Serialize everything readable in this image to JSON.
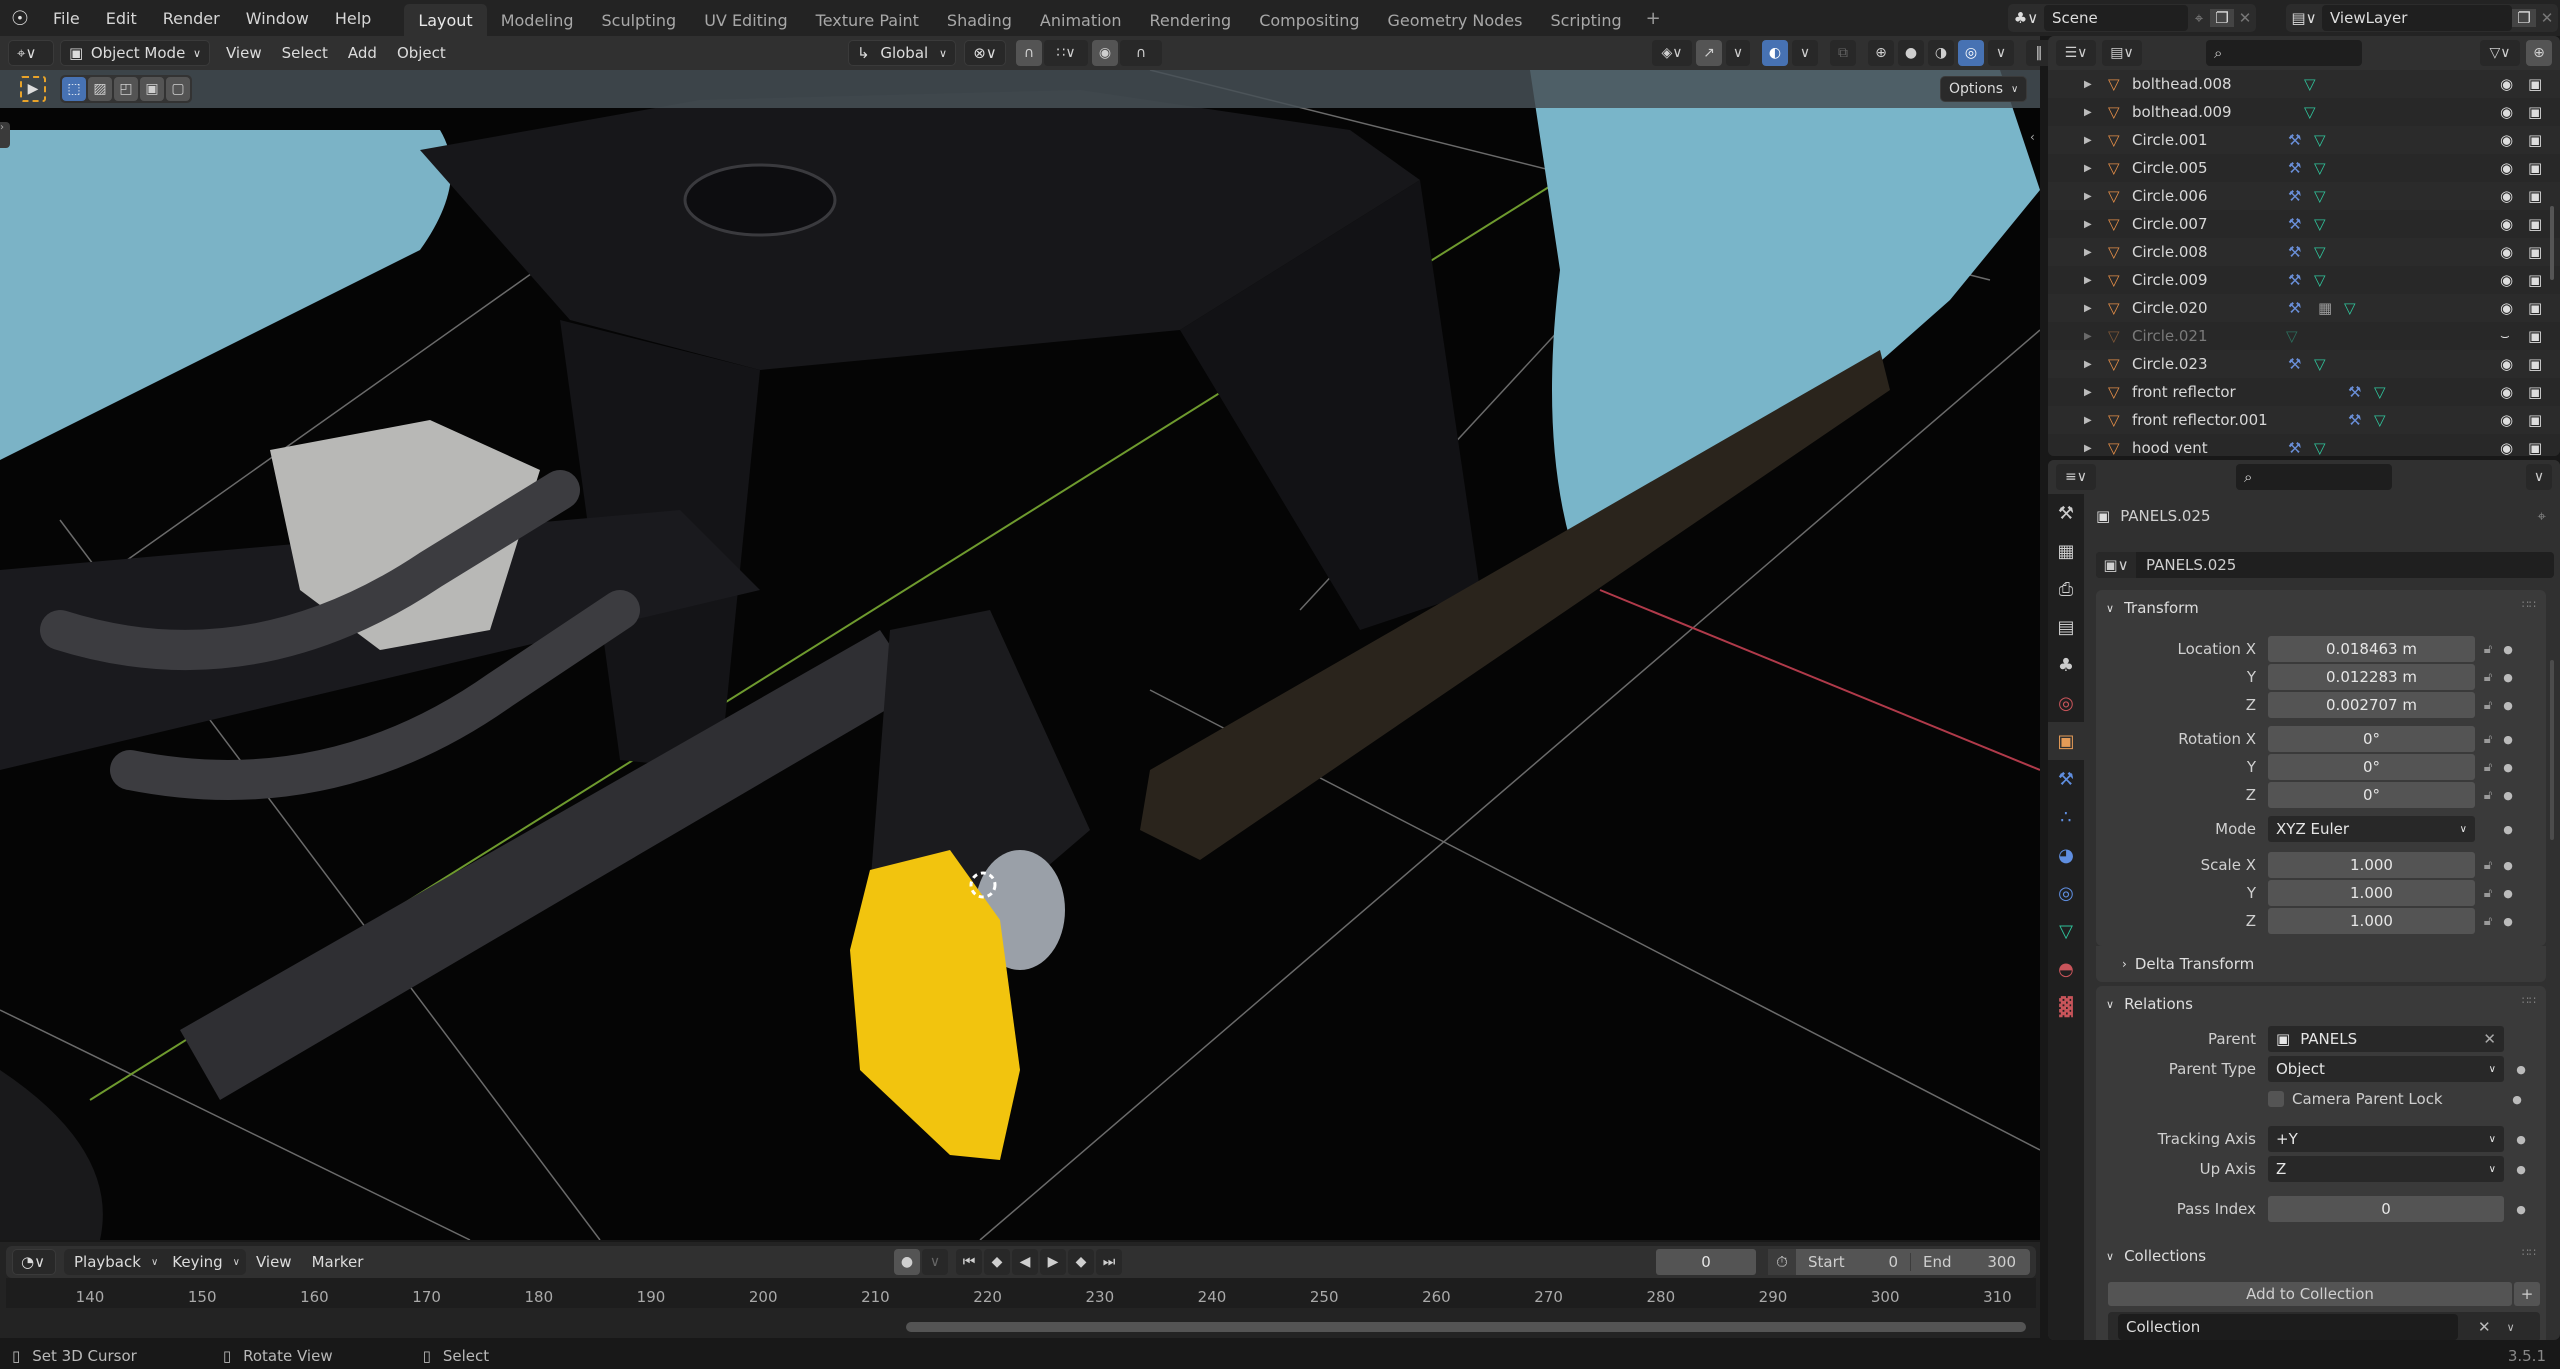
{
  "top_menu": [
    "File",
    "Edit",
    "Render",
    "Window",
    "Help"
  ],
  "workspaces": [
    {
      "label": "Layout",
      "active": true
    },
    {
      "label": "Modeling",
      "active": false
    },
    {
      "label": "Sculpting",
      "active": false
    },
    {
      "label": "UV Editing",
      "active": false
    },
    {
      "label": "Texture Paint",
      "active": false
    },
    {
      "label": "Shading",
      "active": false
    },
    {
      "label": "Animation",
      "active": false
    },
    {
      "label": "Rendering",
      "active": false
    },
    {
      "label": "Compositing",
      "active": false
    },
    {
      "label": "Geometry Nodes",
      "active": false
    },
    {
      "label": "Scripting",
      "active": false
    }
  ],
  "add_workspace": "+",
  "scene": {
    "name": "Scene",
    "view_layer": "ViewLayer"
  },
  "viewport_header": {
    "mode": "Object Mode",
    "menus": [
      "View",
      "Select",
      "Add",
      "Object"
    ],
    "orientation": "Global",
    "options_label": "Options"
  },
  "outliner": {
    "search_placeholder": "",
    "rows": [
      {
        "name": "bolthead.008",
        "modifier": false,
        "extra": false,
        "visible": true,
        "dim": false
      },
      {
        "name": "bolthead.009",
        "modifier": false,
        "extra": false,
        "visible": true,
        "dim": false
      },
      {
        "name": "Circle.001",
        "modifier": true,
        "extra": false,
        "visible": true,
        "dim": false
      },
      {
        "name": "Circle.005",
        "modifier": true,
        "extra": false,
        "visible": true,
        "dim": false
      },
      {
        "name": "Circle.006",
        "modifier": true,
        "extra": false,
        "visible": true,
        "dim": false
      },
      {
        "name": "Circle.007",
        "modifier": true,
        "extra": false,
        "visible": true,
        "dim": false
      },
      {
        "name": "Circle.008",
        "modifier": true,
        "extra": false,
        "visible": true,
        "dim": false
      },
      {
        "name": "Circle.009",
        "modifier": true,
        "extra": false,
        "visible": true,
        "dim": false
      },
      {
        "name": "Circle.020",
        "modifier": true,
        "extra": true,
        "visible": true,
        "dim": false
      },
      {
        "name": "Circle.021",
        "modifier": false,
        "extra": false,
        "visible": false,
        "dim": true
      },
      {
        "name": "Circle.023",
        "modifier": true,
        "extra": false,
        "visible": true,
        "dim": false
      },
      {
        "name": "front reflector",
        "modifier": true,
        "extra": false,
        "visible": true,
        "dim": false
      },
      {
        "name": "front reflector.001",
        "modifier": true,
        "extra": false,
        "visible": true,
        "dim": false
      },
      {
        "name": "hood vent",
        "modifier": true,
        "extra": false,
        "visible": true,
        "dim": false
      }
    ]
  },
  "properties": {
    "object_name": "PANELS.025",
    "datablock_name": "PANELS.025",
    "transform": {
      "title": "Transform",
      "location": {
        "label": "Location X",
        "x": "0.018463 m",
        "y": "0.012283 m",
        "z": "0.002707 m"
      },
      "rotation": {
        "label": "Rotation X",
        "x": "0°",
        "y": "0°",
        "z": "0°"
      },
      "mode": {
        "label": "Mode",
        "value": "XYZ Euler"
      },
      "scale": {
        "label": "Scale X",
        "x": "1.000",
        "y": "1.000",
        "z": "1.000"
      },
      "axis_y": "Y",
      "axis_z": "Z",
      "delta": "Delta Transform"
    },
    "relations": {
      "title": "Relations",
      "parent_label": "Parent",
      "parent_value": "PANELS",
      "parent_type_label": "Parent Type",
      "parent_type_value": "Object",
      "camera_parent_lock": "Camera Parent Lock",
      "tracking_axis_label": "Tracking Axis",
      "tracking_axis_value": "+Y",
      "up_axis_label": "Up Axis",
      "up_axis_value": "Z",
      "pass_index_label": "Pass Index",
      "pass_index_value": "0"
    },
    "collections": {
      "title": "Collections",
      "add_label": "Add to Collection",
      "plus": "+",
      "collection_name": "Collection"
    }
  },
  "timeline": {
    "menus": [
      "Playback",
      "Keying",
      "View",
      "Marker"
    ],
    "current_frame": "0",
    "start_label": "Start",
    "start_value": "0",
    "end_label": "End",
    "end_value": "300",
    "ticks": [
      "140",
      "150",
      "160",
      "170",
      "180",
      "190",
      "200",
      "210",
      "220",
      "230",
      "240",
      "250",
      "260",
      "270",
      "280",
      "290",
      "300",
      "310"
    ]
  },
  "status_bar": {
    "left": "Set 3D Cursor",
    "middle": "Rotate View",
    "right": "Select",
    "version": "3.5.1"
  }
}
